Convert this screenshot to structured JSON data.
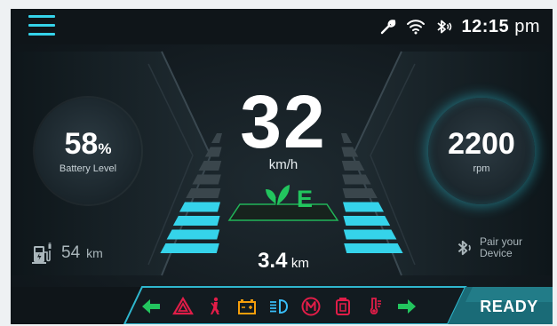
{
  "header": {
    "menu_icon": "hamburger-menu-icon",
    "status_icons": [
      "wrench-icon",
      "wifi-icon",
      "bluetooth-icon"
    ],
    "time": "12:15",
    "ampm": "pm"
  },
  "battery": {
    "value": "58",
    "unit": "%",
    "label": "Battery Level"
  },
  "engine": {
    "rpm": "2200",
    "unit": "rpm"
  },
  "speed": {
    "value": "32",
    "unit": "km/h"
  },
  "drive_mode": {
    "icon": "eco-leaf-icon",
    "letter": "E"
  },
  "trip": {
    "value": "3.4",
    "unit": "km"
  },
  "range": {
    "icon": "charging-station-icon",
    "value": "54",
    "unit": "km"
  },
  "device": {
    "icon": "bluetooth-icon",
    "label": "Pair your Device"
  },
  "level_bars": {
    "total": 9,
    "lit": 4
  },
  "indicators": [
    {
      "name": "left-turn-signal-icon",
      "color": "#22c55e"
    },
    {
      "name": "hazard-warning-icon",
      "color": "#e11d48"
    },
    {
      "name": "seatbelt-warning-icon",
      "color": "#e11d48"
    },
    {
      "name": "battery-warning-icon",
      "color": "#f59e0b"
    },
    {
      "name": "headlight-icon",
      "color": "#38bdf8"
    },
    {
      "name": "motor-fault-icon",
      "color": "#e11d48"
    },
    {
      "name": "fuel-warning-icon",
      "color": "#e11d48"
    },
    {
      "name": "temperature-warning-icon",
      "color": "#e11d48"
    },
    {
      "name": "right-turn-signal-icon",
      "color": "#22c55e"
    }
  ],
  "status": {
    "ready_label": "READY"
  },
  "colors": {
    "accent": "#35d3ea",
    "eco_green": "#22c55e",
    "background": "#131b20"
  }
}
